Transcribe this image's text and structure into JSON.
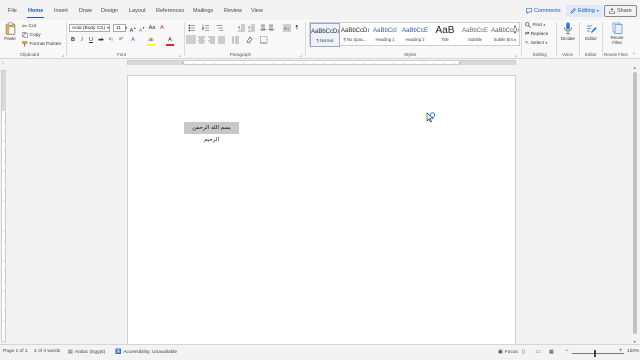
{
  "tabs": [
    {
      "label": "File",
      "active": false
    },
    {
      "label": "Home",
      "active": true
    },
    {
      "label": "Insert",
      "active": false
    },
    {
      "label": "Draw",
      "active": false
    },
    {
      "label": "Design",
      "active": false
    },
    {
      "label": "Layout",
      "active": false
    },
    {
      "label": "References",
      "active": false
    },
    {
      "label": "Mailings",
      "active": false
    },
    {
      "label": "Review",
      "active": false
    },
    {
      "label": "View",
      "active": false
    }
  ],
  "topbar": {
    "comments": "Comments",
    "editing": "Editing",
    "share": "Share"
  },
  "clipboard": {
    "paste": "Paste",
    "cut": "Cut",
    "copy": "Copy",
    "format_painter": "Format Painter",
    "group": "Clipboard"
  },
  "font": {
    "family": "Arial (Body CS)",
    "size": "11",
    "grow": "A",
    "shrink": "A",
    "case": "Aa",
    "clear": "A",
    "bold": "B",
    "italic": "I",
    "underline": "U",
    "strike": "ab",
    "subscript": "x₂",
    "superscript": "x²",
    "effects": "A",
    "highlight": "ab",
    "color": "A",
    "group": "Font"
  },
  "paragraph": {
    "group": "Paragraph",
    "sort": "A↓",
    "show": "¶"
  },
  "styles": {
    "group": "Styles",
    "items": [
      {
        "sample": "AaBbCcDı",
        "name": "¶ Normal",
        "selected": true
      },
      {
        "sample": "AaBbCcDı",
        "name": "¶ No Spac...",
        "selected": false
      },
      {
        "sample": "AaBbCcI",
        "name": "Heading 1",
        "selected": false
      },
      {
        "sample": "AaBbCcE",
        "name": "Heading 2",
        "selected": false
      },
      {
        "sample": "AaB",
        "name": "Title",
        "selected": false
      },
      {
        "sample": "AaBbCcE",
        "name": "Subtitle",
        "selected": false
      },
      {
        "sample": "AaBbCcDı",
        "name": "Subtle Em...",
        "selected": false
      }
    ]
  },
  "editing": {
    "group": "Editing",
    "find": "Find",
    "replace": "Replace",
    "select": "Select"
  },
  "voice": {
    "group": "Voice",
    "dictate": "Dictate"
  },
  "editor": {
    "group": "Editor",
    "editor": "Editor"
  },
  "reuse": {
    "group": "Reuse Files",
    "reuse_label": "Reuse Files"
  },
  "document": {
    "text": "بسم الله الرحمن الرحيم"
  },
  "status": {
    "page": "Page 1 of 1",
    "words": "4 of 4 words",
    "language": "Arabic (Egypt)",
    "accessibility": "Accessibility: Unavailable",
    "focus": "Focus",
    "zoom": "120%"
  },
  "colors": {
    "accent": "#185abd",
    "highlight_bar": "#ffff00",
    "font_color_bar": "#e02020",
    "selection": "#c8c8c8"
  }
}
